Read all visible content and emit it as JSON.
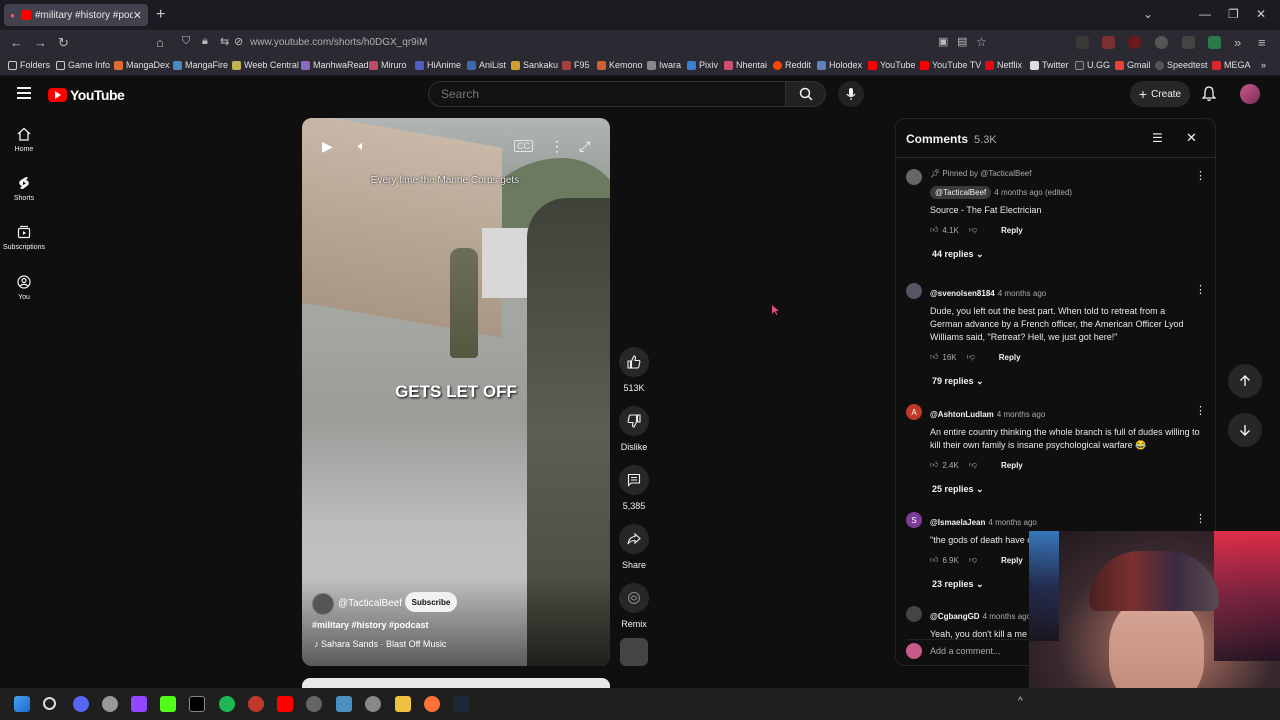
{
  "browser": {
    "tab_title": "#military #history #podcast",
    "url": "www.youtube.com/shorts/h0DGX_qr9iM",
    "bookmarks": [
      "Folders",
      "Game Info",
      "MangaDex",
      "MangaFire",
      "Weeb Central",
      "ManhwaRead",
      "Miruro",
      "HiAnime",
      "AniList",
      "Sankaku",
      "F95",
      "Kemono",
      "Iwara",
      "Pixiv",
      "Nhentai",
      "Reddit",
      "Holodex",
      "YouTube",
      "YouTube TV",
      "Netflix",
      "Twitter",
      "U.GG",
      "Gmail",
      "Speedtest",
      "MEGA"
    ]
  },
  "header": {
    "logo": "YouTube",
    "search_placeholder": "Search",
    "create_label": "Create"
  },
  "sidebar": {
    "items": [
      {
        "label": "Home",
        "icon": "home-icon"
      },
      {
        "label": "Shorts",
        "icon": "shorts-icon"
      },
      {
        "label": "Subscriptions",
        "icon": "subscriptions-icon"
      },
      {
        "label": "You",
        "icon": "you-icon"
      }
    ]
  },
  "video": {
    "caption_top": "Every time the Marine Corps gets",
    "caption_mid": "GETS LET OFF",
    "channel": "@TacticalBeef",
    "subscribe_label": "Subscribe",
    "tags": "#military #history #podcast",
    "music": "Sahara Sands · Blast Off Music"
  },
  "actions": {
    "likes": "513K",
    "dislike_label": "Dislike",
    "comments": "5,385",
    "share_label": "Share",
    "remix_label": "Remix"
  },
  "comments": {
    "title": "Comments",
    "count": "5.3K",
    "add_placeholder": "Add a comment...",
    "reply_label": "Reply",
    "items": [
      {
        "pinned": "Pinned by @TacticalBeef",
        "user": "@TacticalBeef",
        "time": "4 months ago (edited)",
        "text": "Source - The Fat Electrician",
        "likes": "4.1K",
        "replies": "44 replies"
      },
      {
        "user": "@svenolsen8184",
        "time": "4 months ago",
        "text": "Dude, you left out the best part. When told to retreat from a German advance by a French officer, the American Officer Lyod Williams said, \"Retreat? Hell, we just got here!\"",
        "likes": "16K",
        "replies": "79 replies"
      },
      {
        "user": "@AshtonLudlam",
        "time": "4 months ago",
        "text": "An entire country thinking the whole branch is full of dudes willing to kill their own family is insane psychological warfare 😂",
        "likes": "2.4K",
        "replies": "25 replies",
        "initial": "A"
      },
      {
        "user": "@IsmaelaJean",
        "time": "4 months ago",
        "text": "\"the gods of death have come\" is a cold introduction",
        "likes": "6.9K",
        "replies": "23 replies",
        "initial": "S"
      },
      {
        "user": "@CgbangGD",
        "time": "4 months ago",
        "text": "Yeah, you don't kill a me"
      }
    ]
  },
  "colors": {
    "background": "#0f0f0f",
    "youtube_red": "#ff0000",
    "surface": "#272727"
  }
}
